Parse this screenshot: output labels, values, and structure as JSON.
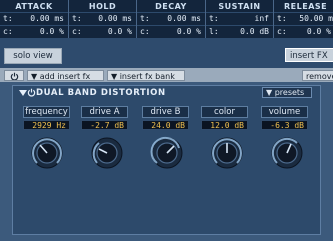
{
  "envelope": {
    "columns": [
      {
        "title": "ATTACK",
        "row1_key": "t:",
        "row1_val": "0.00 ms",
        "row2_key": "c:",
        "row2_val": "0.0 %"
      },
      {
        "title": "HOLD",
        "row1_key": "t:",
        "row1_val": "0.00 ms",
        "row2_key": "c:",
        "row2_val": "0.0 %"
      },
      {
        "title": "DECAY",
        "row1_key": "t:",
        "row1_val": "0.00 ms",
        "row2_key": "c:",
        "row2_val": "0.0 %"
      },
      {
        "title": "SUSTAIN",
        "row1_key": "t:",
        "row1_val": "inf",
        "row2_key": "l:",
        "row2_val": "0.0 dB"
      },
      {
        "title": "RELEASE",
        "row1_key": "t:",
        "row1_val": "50.00 m",
        "row2_key": "c:",
        "row2_val": "0.0 %"
      }
    ]
  },
  "toolbar": {
    "solo_label": "solo view",
    "insert_fx_label": "insert FX",
    "add_insert_label": "add insert fx",
    "insert_bank_label": "insert fx bank",
    "remove_label": "remove"
  },
  "plugin": {
    "title": "DUAL BAND DISTORTION",
    "presets_label": "presets",
    "params": [
      {
        "label": "frequency",
        "value": "2929 Hz"
      },
      {
        "label": "drive A",
        "value": "-2.7 dB"
      },
      {
        "label": "drive B",
        "value": "24.0 dB"
      },
      {
        "label": "color",
        "value": "12.0 dB"
      },
      {
        "label": "volume",
        "value": "-6.3 dB"
      }
    ]
  },
  "colors": {
    "background": "#3c5a7c",
    "header": "#13253c",
    "value_text": "#f0c050",
    "panel": "#2d4a6b"
  }
}
